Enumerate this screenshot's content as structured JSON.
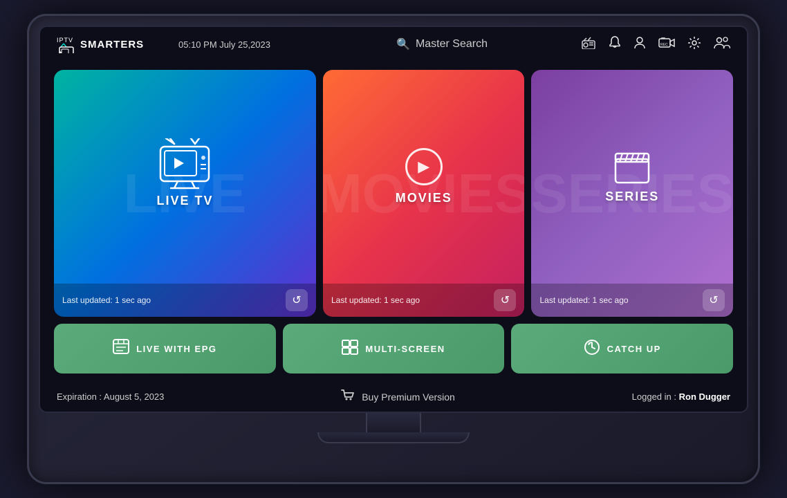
{
  "header": {
    "logo_iptv": "IPTV",
    "logo_smarters": "SMARTERS",
    "datetime": "05:10 PM   July 25,2023",
    "search_label": "Master Search"
  },
  "nav_icons": {
    "radio": "📻",
    "bell": "🔔",
    "user": "👤",
    "record": "🎥",
    "settings": "⚙",
    "multiuser": "👥"
  },
  "cards": {
    "live_tv": {
      "label": "LIVE TV",
      "last_updated": "Last updated: 1 sec ago",
      "watermark": "LIVE"
    },
    "movies": {
      "label": "MOVIES",
      "last_updated": "Last updated: 1 sec ago",
      "watermark": "MOVIES"
    },
    "series": {
      "label": "SERIES",
      "last_updated": "Last updated: 1 sec ago",
      "watermark": "SERIES"
    }
  },
  "bottom_cards": [
    {
      "icon": "📖",
      "label": "LIVE WITH EPG"
    },
    {
      "icon": "⊞",
      "label": "MULTI-SCREEN"
    },
    {
      "icon": "🕐",
      "label": "CATCH UP"
    }
  ],
  "footer": {
    "expiration": "Expiration : August 5, 2023",
    "buy_premium": "Buy Premium Version",
    "logged_in_prefix": "Logged in : ",
    "user_name": "Ron Dugger"
  },
  "colors": {
    "live_tv_gradient_start": "#00b4a0",
    "live_tv_gradient_end": "#6030d0",
    "movies_gradient_start": "#ff6b35",
    "movies_gradient_end": "#c42060",
    "series_gradient_start": "#7b3fa0",
    "series_gradient_end": "#b070d0",
    "green_card": "#5aaa7a"
  }
}
